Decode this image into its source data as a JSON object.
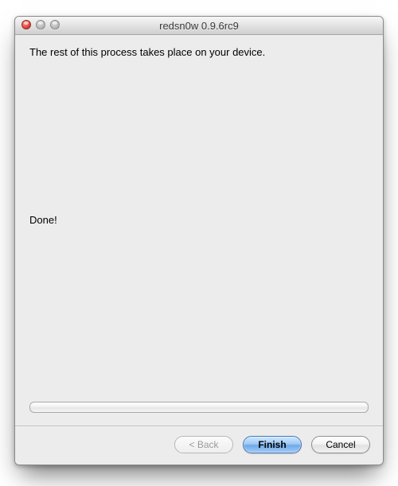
{
  "window": {
    "title": "redsn0w 0.9.6rc9"
  },
  "content": {
    "message": "The rest of this process takes place on your device.",
    "status": "Done!"
  },
  "footer": {
    "back_label": "< Back",
    "finish_label": "Finish",
    "cancel_label": "Cancel"
  }
}
